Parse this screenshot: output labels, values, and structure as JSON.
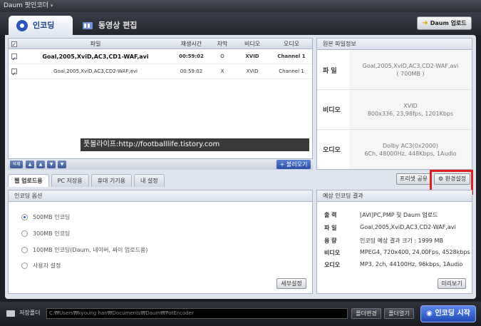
{
  "app": {
    "title": "Daum 팟인코더",
    "menu_glyph": "▾"
  },
  "tabs": [
    {
      "label": "인코딩"
    },
    {
      "label": "동영상 편집"
    }
  ],
  "daum_upload_label": "Daum 업로드",
  "file_list": {
    "columns": [
      "파일",
      "재생시간",
      "자막",
      "비디오",
      "오디오"
    ],
    "rows": [
      {
        "name": "Goal,2005,XviD,AC3,CD1-WAF,avi",
        "time": "00:59:02",
        "sub": "O",
        "video": "XVID",
        "audio": "Channel 1"
      },
      {
        "name": "Goal,2005,XviD,AC3,CD2-WAF,avi",
        "time": "00:59:02",
        "sub": "X",
        "video": "XVID",
        "audio": "Channel 1"
      }
    ],
    "nav_buttons": [
      "삭제",
      "▲",
      "▲",
      "▼",
      "▼"
    ],
    "load_button": "불러오기"
  },
  "watermark": "풋볼라이프:http://footballlife.tistory.com",
  "original_info": {
    "title": "원본 파일정보",
    "file_label": "파 일",
    "file_value_1": "Goal,2005,XviD,AC3,CD2-WAF,avi",
    "file_value_2": "( 700MB )",
    "video_label": "비디오",
    "video_value_1": "XVID",
    "video_value_2": "800x336, 23,98fps, 1201Kbps",
    "audio_label": "오디오",
    "audio_value_1": "Dolby AC3(0x2000)",
    "audio_value_2": "6Ch, 48000Hz, 448Kbps, 1Audio"
  },
  "sub_tabs": [
    "웹 업로드용",
    "PC 저장용",
    "휴대 기기용",
    "내 설정"
  ],
  "preset_share_label": "프리셋 공유",
  "env_settings_label": "환경설정",
  "encoding_options": {
    "title": "인코딩 옵션",
    "options": [
      "500MB 인코딩",
      "300MB 인코딩",
      "100MB 인코딩(Daum, 네이버, 싸이 업로드용)",
      "사용자 설정"
    ],
    "selected": 0,
    "detail_button": "세부설정"
  },
  "expected_result": {
    "title": "예상 인코딩 결과",
    "rows": [
      {
        "label": "출 력",
        "value": "[AVI]PC,PMP 및 Daum 업로드"
      },
      {
        "label": "파 일",
        "value": "Goal,2005,XviD,AC3,CD2-WAF,avi"
      },
      {
        "label": "용 량",
        "value": "인코딩 예상 결과 크기 : 1999 MB"
      },
      {
        "label": "비디오",
        "value": "MPEG4, 720x400, 24,00Fps, 4528kbps"
      },
      {
        "label": "오디오",
        "value": "MP3, 2ch, 44100Hz, 96kbps, 1Audio"
      }
    ],
    "preview_button": "미리보기"
  },
  "bottom": {
    "save_folder_label": "저장폴더",
    "path": "C:₩Users₩kyoung han₩Documents₩Daum₩PotEncoder",
    "change_folder": "폴더변경",
    "open_folder": "폴더열기",
    "start_button": "인코딩 시작"
  },
  "colors": {
    "accent": "#2a4fa5",
    "highlight": "#e02020"
  }
}
